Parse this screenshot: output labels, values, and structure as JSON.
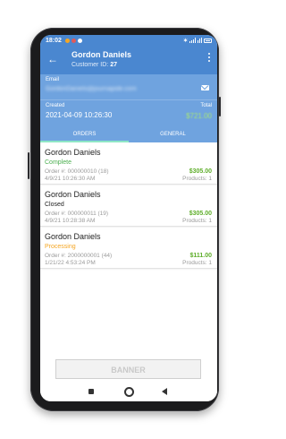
{
  "status_bar": {
    "time": "18:02",
    "battery_label": "▮"
  },
  "app_bar": {
    "back_icon": "arrow-back-icon",
    "title": "Gordon Daniels",
    "customer_id_label": "Customer ID:",
    "customer_id": "27",
    "menu_icon": "more-vert-icon"
  },
  "info": {
    "email_label": "Email",
    "email_value": "GordonDaniels@journapide.com",
    "created_label": "Created",
    "created_value": "2021-04-09 10:26:30",
    "total_label": "Total",
    "total_value": "$721.00"
  },
  "tabs": [
    {
      "label": "ORDERS",
      "active": true
    },
    {
      "label": "GENERAL",
      "active": false
    }
  ],
  "orders": [
    {
      "name": "Gordon Daniels",
      "status": "Complete",
      "status_color": "#4caf50",
      "order_no": "Order #: 000000010 (18)",
      "date": "4/9/21 10:26:30 AM",
      "total": "$305.00",
      "products": "Products: 1"
    },
    {
      "name": "Gordon Daniels",
      "status": "Closed",
      "status_color": "#222222",
      "order_no": "Order #: 000000011 (19)",
      "date": "4/9/21 10:28:38 AM",
      "total": "$305.00",
      "products": "Products: 1"
    },
    {
      "name": "Gordon Daniels",
      "status": "Processing",
      "status_color": "#f5a623",
      "order_no": "Order #: 2000000001 (44)",
      "date": "1/21/22 4:53:24 PM",
      "total": "$111.00",
      "products": "Products: 1"
    }
  ],
  "banner": {
    "label": "BANNER"
  },
  "colors": {
    "primary": "#4a87d0",
    "header_info": "#6fa3df",
    "price_green": "#5fae2b",
    "tab_indicator": "#8ee6c6"
  }
}
